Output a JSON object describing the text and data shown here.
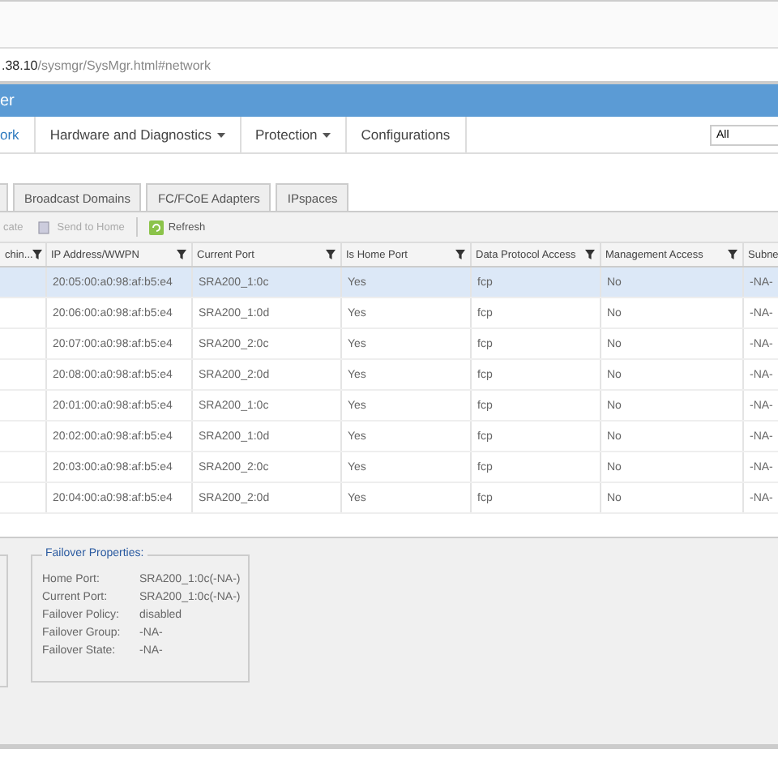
{
  "address_bar": {
    "host": ".38.10",
    "path": "/sysmgr/SysMgr.html#network"
  },
  "app_header": {
    "title": "er"
  },
  "nav": {
    "items": [
      {
        "label": "ork",
        "selected": true,
        "dropdown": false
      },
      {
        "label": "Hardware and Diagnostics",
        "selected": false,
        "dropdown": true
      },
      {
        "label": "Protection",
        "selected": false,
        "dropdown": true
      },
      {
        "label": "Configurations",
        "selected": false,
        "dropdown": false
      }
    ],
    "search_scope": "All"
  },
  "tabs": [
    {
      "selected": false
    },
    {
      "label": "Broadcast Domains",
      "selected": false
    },
    {
      "label": "FC/FCoE Adapters",
      "selected": false
    },
    {
      "label": "IPspaces",
      "selected": false
    }
  ],
  "toolbar": [
    {
      "label": "cate",
      "disabled": true,
      "kind": "text"
    },
    {
      "label": "Send to Home",
      "disabled": true,
      "kind": "home"
    },
    {
      "label": "Refresh",
      "disabled": false,
      "kind": "refresh"
    }
  ],
  "table": {
    "columns": [
      {
        "label": "chin...",
        "filter": true
      },
      {
        "label": "IP Address/WWPN",
        "filter": true
      },
      {
        "label": "Current Port",
        "filter": true
      },
      {
        "label": "Is Home Port",
        "filter": true
      },
      {
        "label": "Data Protocol Access",
        "filter": true
      },
      {
        "label": "Management Access",
        "filter": true
      },
      {
        "label": "Subne"
      }
    ],
    "rows": [
      {
        "selected": true,
        "cells": [
          "",
          "20:05:00:a0:98:af:b5:e4",
          "SRA200_1:0c",
          "Yes",
          "fcp",
          "No",
          "-NA-"
        ]
      },
      {
        "selected": false,
        "cells": [
          "",
          "20:06:00:a0:98:af:b5:e4",
          "SRA200_1:0d",
          "Yes",
          "fcp",
          "No",
          "-NA-"
        ]
      },
      {
        "selected": false,
        "cells": [
          "",
          "20:07:00:a0:98:af:b5:e4",
          "SRA200_2:0c",
          "Yes",
          "fcp",
          "No",
          "-NA-"
        ]
      },
      {
        "selected": false,
        "cells": [
          "",
          "20:08:00:a0:98:af:b5:e4",
          "SRA200_2:0d",
          "Yes",
          "fcp",
          "No",
          "-NA-"
        ]
      },
      {
        "selected": false,
        "cells": [
          "",
          "20:01:00:a0:98:af:b5:e4",
          "SRA200_1:0c",
          "Yes",
          "fcp",
          "No",
          "-NA-"
        ]
      },
      {
        "selected": false,
        "cells": [
          "",
          "20:02:00:a0:98:af:b5:e4",
          "SRA200_1:0d",
          "Yes",
          "fcp",
          "No",
          "-NA-"
        ]
      },
      {
        "selected": false,
        "cells": [
          "",
          "20:03:00:a0:98:af:b5:e4",
          "SRA200_2:0c",
          "Yes",
          "fcp",
          "No",
          "-NA-"
        ]
      },
      {
        "selected": false,
        "cells": [
          "",
          "20:04:00:a0:98:af:b5:e4",
          "SRA200_2:0d",
          "Yes",
          "fcp",
          "No",
          "-NA-"
        ]
      }
    ]
  },
  "failover": {
    "title": "Failover Properties:",
    "fields": [
      {
        "label": "Home Port:",
        "value": "SRA200_1:0c(-NA-)"
      },
      {
        "label": "Current Port:",
        "value": "SRA200_1:0c(-NA-)"
      },
      {
        "label": "Failover Policy:",
        "value": "disabled"
      },
      {
        "label": "Failover Group:",
        "value": "-NA-"
      },
      {
        "label": "Failover State:",
        "value": "-NA-"
      }
    ]
  }
}
